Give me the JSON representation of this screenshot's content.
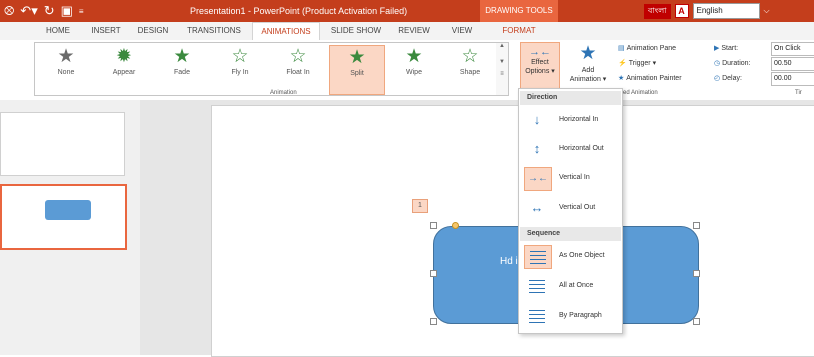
{
  "title_bar": {
    "title": "Presentation1 - PowerPoint (Product Activation Failed)",
    "contextual_tab_group": "DRAWING TOOLS",
    "input_lang_indicator": "বাংলা",
    "language": "English"
  },
  "tabs": [
    {
      "label": "HOME"
    },
    {
      "label": "INSERT"
    },
    {
      "label": "DESIGN"
    },
    {
      "label": "TRANSITIONS"
    },
    {
      "label": "ANIMATIONS"
    },
    {
      "label": "SLIDE SHOW"
    },
    {
      "label": "REVIEW"
    },
    {
      "label": "VIEW"
    },
    {
      "label": "FORMAT"
    }
  ],
  "animation_gallery": {
    "items": [
      {
        "label": "None"
      },
      {
        "label": "Appear"
      },
      {
        "label": "Fade"
      },
      {
        "label": "Fly In"
      },
      {
        "label": "Float In"
      },
      {
        "label": "Split"
      },
      {
        "label": "Wipe"
      },
      {
        "label": "Shape"
      }
    ],
    "selected": "Split",
    "group_label": "Animation"
  },
  "effect_options": {
    "line1": "Effect",
    "line2": "Options ▾"
  },
  "add_animation": {
    "line1": "Add",
    "line2": "Animation ▾"
  },
  "advanced": {
    "animation_pane": "Animation Pane",
    "trigger": "Trigger ▾",
    "animation_painter": "Animation Painter",
    "group_label": "ced Animation"
  },
  "timing": {
    "start_label": "Start:",
    "start_value": "On Click",
    "duration_label": "Duration:",
    "duration_value": "00.50",
    "delay_label": "Delay:",
    "delay_value": "00.00",
    "group_label": "Tir"
  },
  "slide": {
    "sequence_badge": "1",
    "shape_text": "Hd                    i"
  },
  "dropdown": {
    "direction_header": "Direction",
    "direction_items": [
      {
        "label": "Horizontal In"
      },
      {
        "label": "Horizontal Out"
      },
      {
        "label": "Vertical In"
      },
      {
        "label": "Vertical Out"
      }
    ],
    "selected_direction": "Vertical In",
    "sequence_header": "Sequence",
    "sequence_items": [
      {
        "label": "As One Object"
      },
      {
        "label": "All at Once"
      },
      {
        "label": "By Paragraph"
      }
    ],
    "selected_sequence": "As One Object"
  },
  "colors": {
    "accent": "#c43e1c",
    "selection": "#fbd7c5",
    "shape_fill": "#5b9bd5"
  }
}
